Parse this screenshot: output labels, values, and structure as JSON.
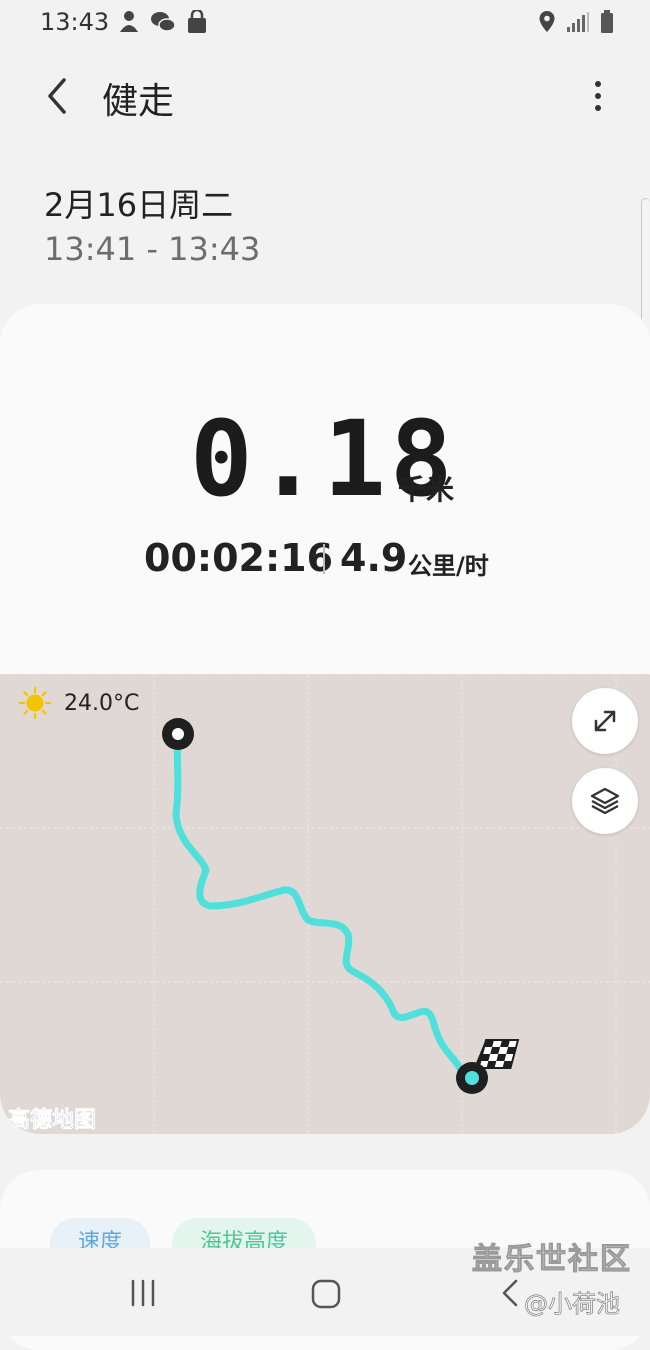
{
  "status_bar": {
    "time": "13:43",
    "left_icons": [
      "person-icon",
      "wechat-icon",
      "shopping-bag-icon"
    ],
    "right_icons": [
      "location-icon",
      "signal-icon",
      "battery-icon"
    ]
  },
  "header": {
    "title": "健走"
  },
  "session": {
    "date": "2月16日周二",
    "time_range": "13:41 - 13:43"
  },
  "summary": {
    "distance_value": "0.18",
    "distance_unit": "千米",
    "duration": "00:02:16",
    "speed_value": "4.9",
    "speed_unit": "公里/时"
  },
  "map": {
    "temperature": "24.0°C",
    "attribution": "高德地图",
    "route_color": "#4fe0dc",
    "background_color": "#dfd8d5"
  },
  "details": {
    "chips": [
      {
        "label": "速度"
      },
      {
        "label": "海拔高度"
      }
    ]
  },
  "watermark": {
    "site": "盖乐世社区",
    "user": "@小荷池"
  }
}
